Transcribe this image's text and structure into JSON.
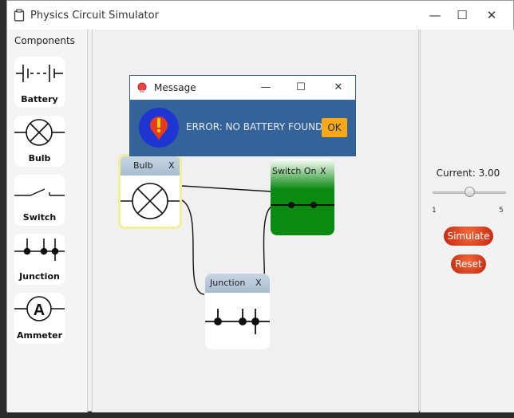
{
  "window": {
    "title": "Physics Circuit Simulator",
    "minimize": "—",
    "maximize": "☐",
    "close": "✕"
  },
  "palette": {
    "header": "Components",
    "items": [
      {
        "label": "Battery",
        "icon": "battery-icon"
      },
      {
        "label": "Bulb",
        "icon": "bulb-icon"
      },
      {
        "label": "Switch",
        "icon": "switch-icon"
      },
      {
        "label": "Junction",
        "icon": "junction-icon"
      },
      {
        "label": "Ammeter",
        "icon": "ammeter-icon",
        "symbol": "A"
      }
    ]
  },
  "canvas": {
    "components": [
      {
        "name": "Bulb",
        "close": "X",
        "icon": "bulb-icon"
      },
      {
        "name": "Switch On",
        "close": "X",
        "icon": "switch-icon"
      },
      {
        "name": "Junction",
        "close": "X",
        "icon": "junction-icon"
      }
    ]
  },
  "controls": {
    "current_label": "Current: 3.00",
    "slider": {
      "min_label": "1",
      "max_label": "5",
      "min": 1,
      "max": 5,
      "value": 3.0
    },
    "simulate": "Simulate",
    "reset": "Reset"
  },
  "dialog": {
    "title": "Message",
    "minimize": "—",
    "maximize": "☐",
    "close": "✕",
    "message": "ERROR: NO BATTERY FOUND!",
    "ok": "OK",
    "icon": "error-icon"
  },
  "colors": {
    "switch_on_green": "#0a8a10",
    "selected_highlight": "#f3f09a",
    "button_red": "#d8361a",
    "dialog_blue": "#34639a",
    "ok_yellow": "#f6a817"
  }
}
